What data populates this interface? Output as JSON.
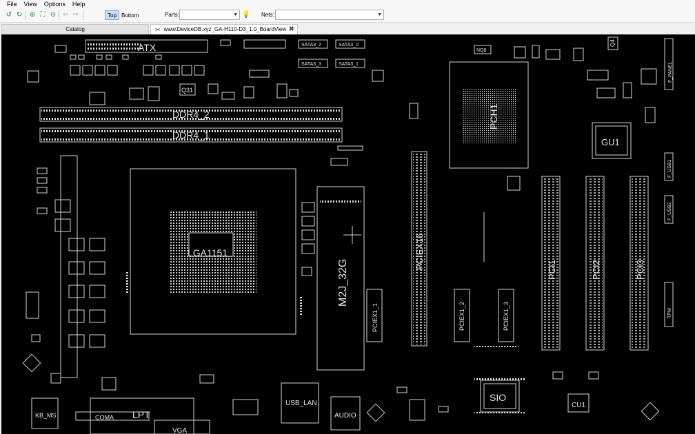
{
  "menu": [
    "File",
    "View",
    "Options",
    "Help"
  ],
  "toolbar": {
    "layer_top": "Top",
    "layer_bottom": "Bottom",
    "parts_label": "Parts:",
    "parts_value": "",
    "nets_label": "Nets:",
    "nets_value": ""
  },
  "tabs": {
    "catalog": "Catalog",
    "board": "www.DeviceDB.xyz_GA-H110-D3_1.0_BoardView"
  },
  "board": {
    "atx": "ATX",
    "ddr4_2": "DDR4_2",
    "ddr4_1": "DDR4_1",
    "cpu_socket": "LGA1151",
    "m2": "M2J_32G",
    "pciex16": "PCIEX16",
    "pciex1_1": "PCIEX1_1",
    "pciex1_2": "PCIEX1_2",
    "pciex1_3": "PCIEX1_3",
    "pci1": "PCI1",
    "pci2": "PCI2",
    "pci3": "PCI3",
    "pch": "PCH1",
    "gu1": "GU1",
    "sio": "SIO",
    "cu1": "CU1",
    "lpt": "LPT",
    "kb_ms": "KB_MS",
    "usb_lan": "USB_LAN",
    "audio": "AUDIO",
    "vga": "VGA",
    "coma": "COMA",
    "sata3_2": "SATA3_2",
    "sata3_0": "SATA3_0",
    "sata3_3": "SATA3_3",
    "sata3_1": "SATA3_1",
    "f_panel": "F_PANEL",
    "f_usb1": "F_USB1",
    "f_usb2": "F_USB2",
    "tpm": "TPM",
    "q31": "Q31",
    "q4": "Q4",
    "nq8": "NQ8"
  }
}
